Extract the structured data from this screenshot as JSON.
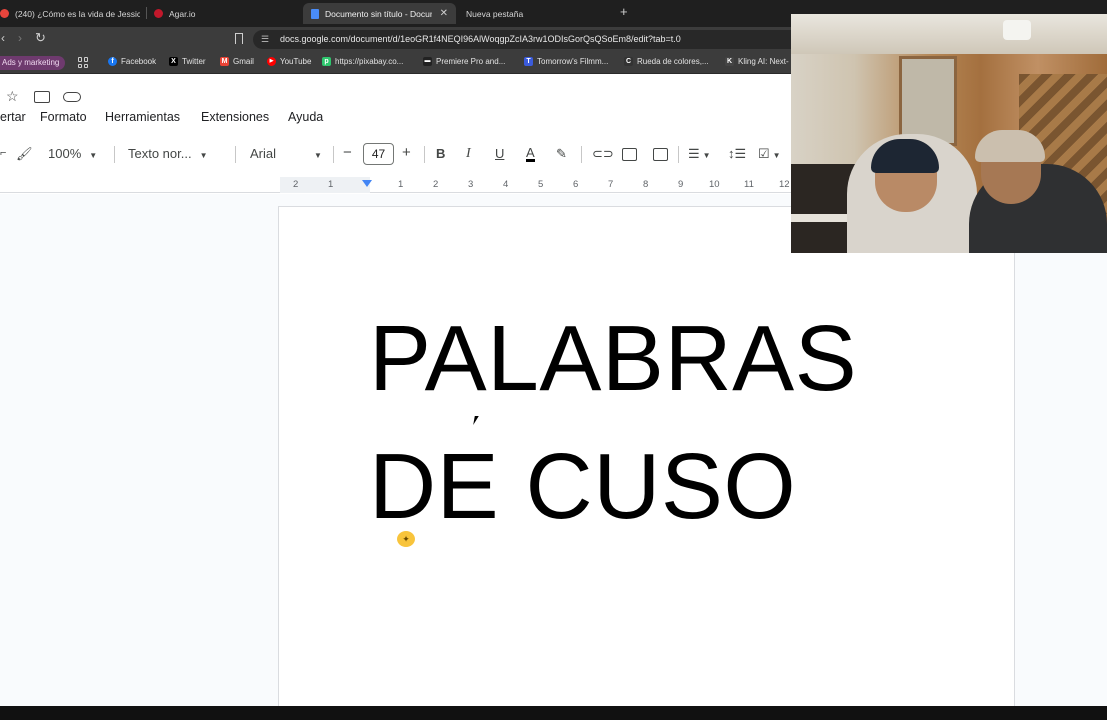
{
  "browser": {
    "tabs": [
      {
        "label": "(240) ¿Cómo es la vida de Jessic",
        "color": "#e8453c"
      },
      {
        "label": "Agar.io",
        "color": "#c2182b"
      },
      {
        "label": "Documento sin título - Docum",
        "active": true
      },
      {
        "label": "Nueva pestaña"
      }
    ],
    "url": "docs.google.com/document/d/1eoGR1f4NEQI96AlWoqgpZcIA3rw1ODIsGorQsQSoEm8/edit?tab=t.0",
    "bookmarks": [
      {
        "label": "Ads y marketing",
        "chip": true
      },
      {
        "label": "Facebook",
        "icon": "facebook-icon",
        "color": "#1877f2",
        "glyph": "f"
      },
      {
        "label": "Twitter",
        "icon": "x-icon",
        "color": "#000000",
        "glyph": "X"
      },
      {
        "label": "Gmail",
        "icon": "gmail-icon",
        "color": "#ea4335",
        "glyph": "M"
      },
      {
        "label": "YouTube",
        "icon": "youtube-icon",
        "color": "#ff0000",
        "glyph": "▶"
      },
      {
        "label": "https://pixabay.co...",
        "icon": "pixabay-icon",
        "color": "#2ec66d",
        "glyph": "p"
      },
      {
        "label": "Premiere Pro and...",
        "icon": "premiere-icon",
        "color": "#222222",
        "glyph": "▬"
      },
      {
        "label": "Tomorrow's Filmm...",
        "icon": "filmmaker-icon",
        "color": "#3b5bdb",
        "glyph": "T"
      },
      {
        "label": "Rueda de colores,...",
        "icon": "adobe-color-icon",
        "color": "#333333",
        "glyph": "C"
      },
      {
        "label": "Kling AI: Next-",
        "icon": "kling-icon",
        "color": "#444444",
        "glyph": "K"
      }
    ]
  },
  "docs": {
    "menu": [
      "ertar",
      "Formato",
      "Herramientas",
      "Extensiones",
      "Ayuda"
    ],
    "toolbar": {
      "zoom": "100%",
      "style": "Texto nor...",
      "font": "Arial",
      "font_size": "47",
      "bold": "B",
      "italic": "I",
      "underline": "U",
      "text_color": "A"
    },
    "ruler": [
      "2",
      "1",
      "1",
      "2",
      "3",
      "4",
      "5",
      "6",
      "7",
      "8",
      "9",
      "10",
      "11",
      "12"
    ],
    "content": {
      "line1": "PALABRAS",
      "line2": "DE CUSO"
    }
  }
}
